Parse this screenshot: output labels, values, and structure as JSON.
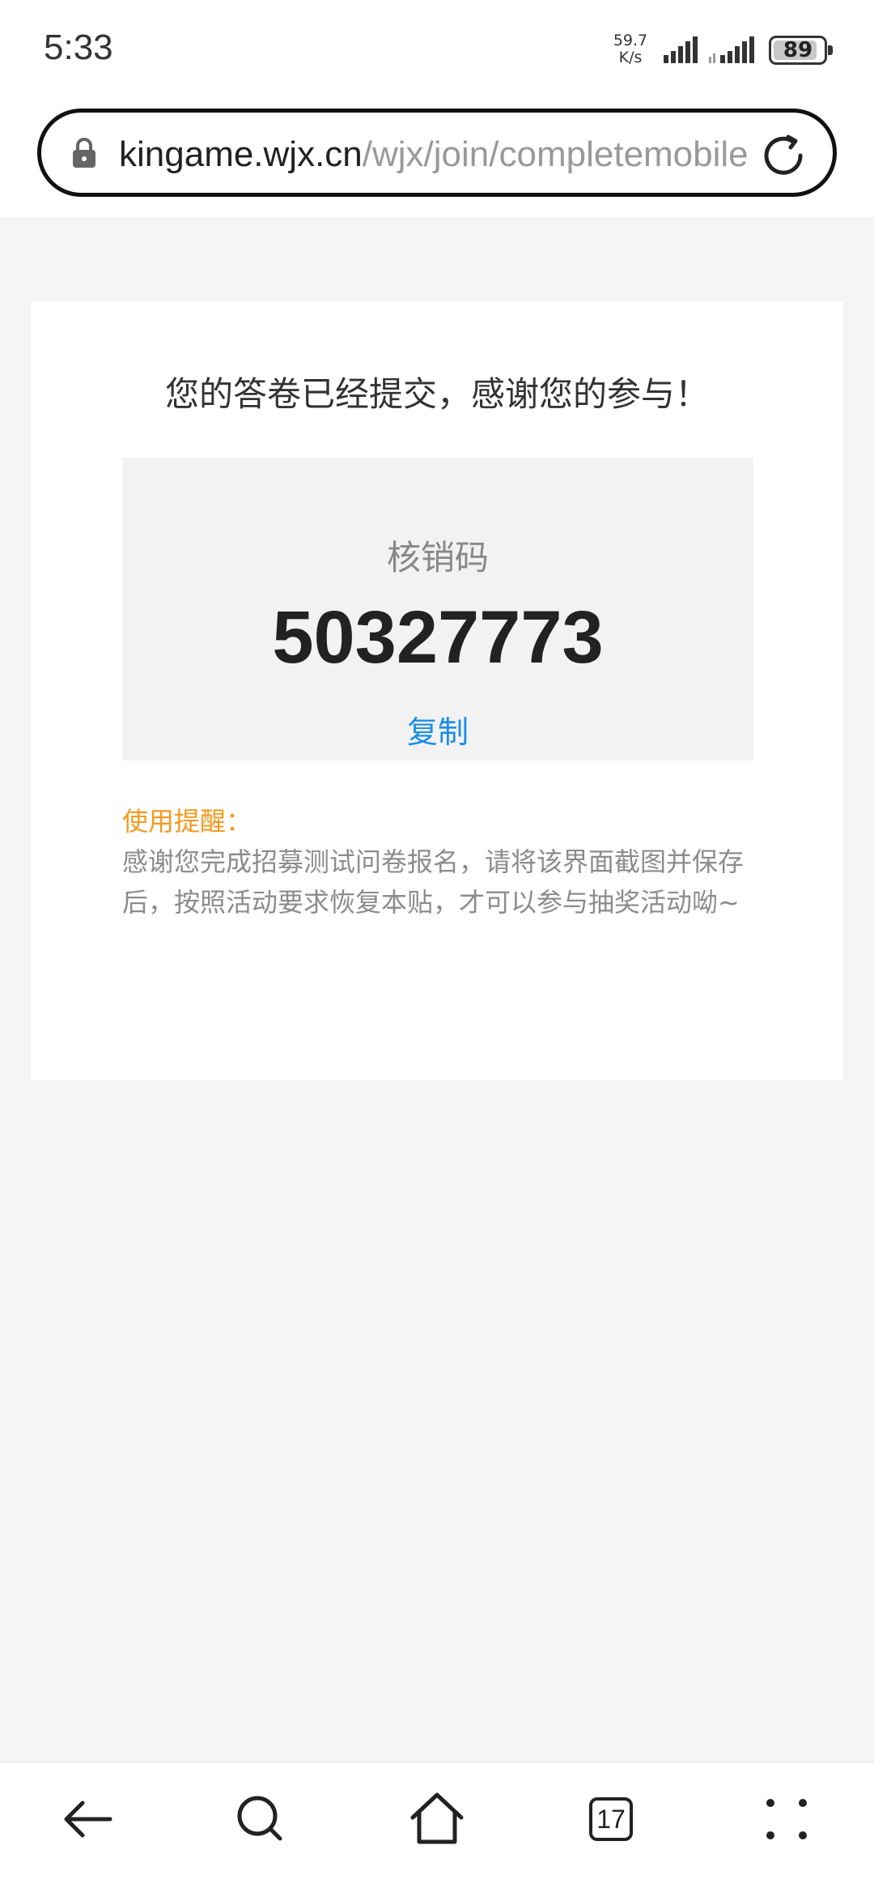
{
  "status_bar": {
    "time": "5:33",
    "net_speed_value": "59.7",
    "net_speed_unit": "K/s",
    "battery": "89",
    "battery_level": 0.89
  },
  "browser": {
    "url_domain": "kingame.wjx.cn",
    "url_path": "/wjx/join/completemobile"
  },
  "card": {
    "headline": "您的答卷已经提交，感谢您的参与！",
    "code_label": "核销码",
    "code_value": "50327773",
    "copy_label": "复制",
    "tip_title": "使用提醒：",
    "tip_body": "感谢您完成招募测试问卷报名，请将该界面截图并保存后，按照活动要求恢复本贴，才可以参与抽奖活动呦~"
  },
  "bottom_nav": {
    "tab_count": "17"
  },
  "colors": {
    "accent_link": "#1a8ee6",
    "tip_title": "#f39a1e",
    "page_bg": "#f5f5f5"
  }
}
